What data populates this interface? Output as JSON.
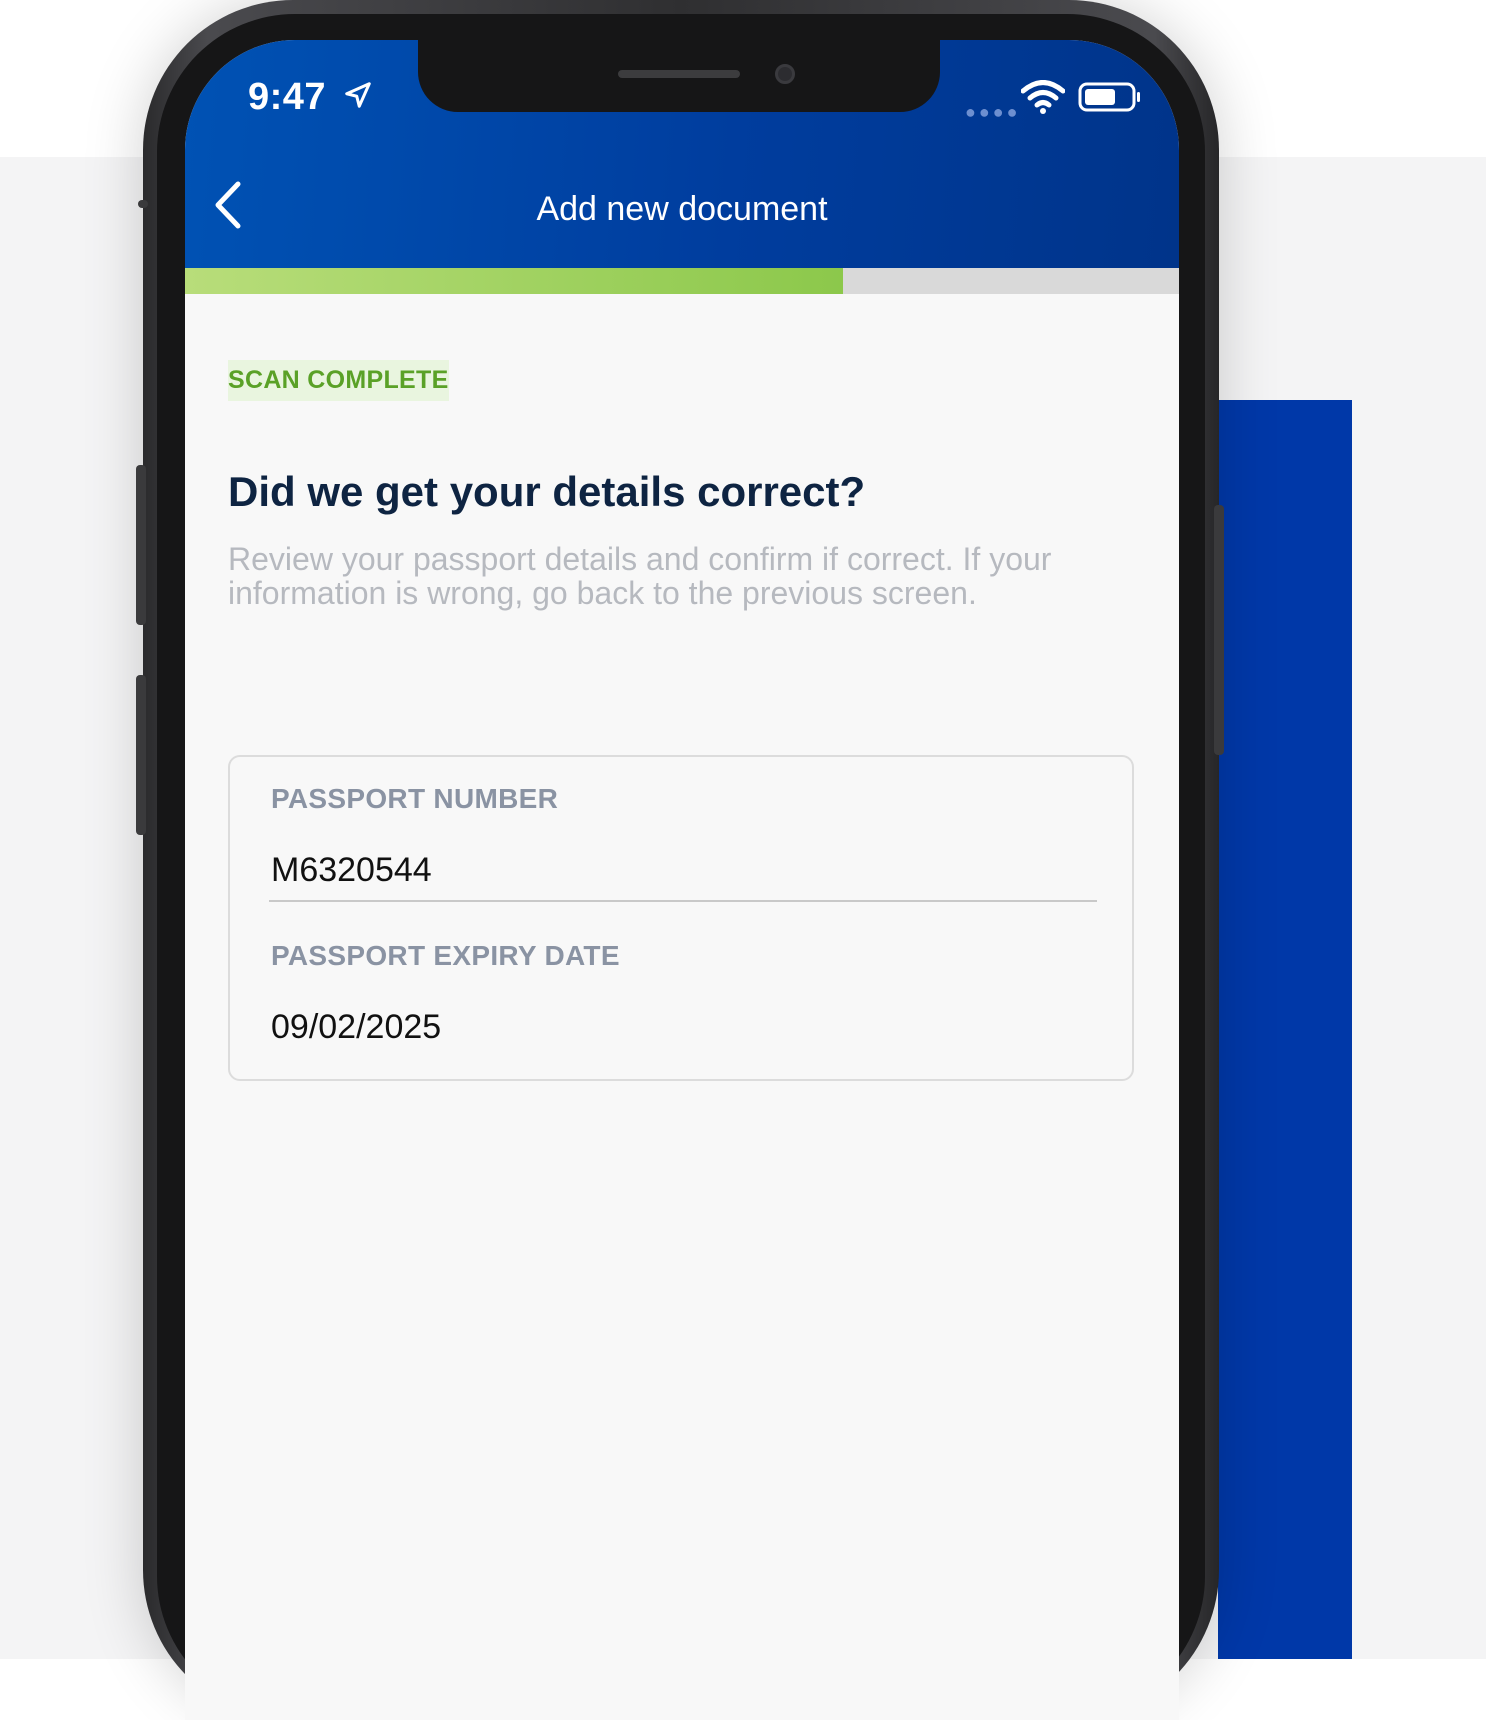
{
  "status_bar": {
    "time": "9:47"
  },
  "header": {
    "title": "Add new document"
  },
  "progress": {
    "fraction": 0.662
  },
  "content": {
    "badge": "SCAN COMPLETE",
    "heading": "Did we get your details correct?",
    "subtitle": "Review your passport details and confirm if correct. If your information is wrong, go back to the previous screen."
  },
  "fields": [
    {
      "label": "PASSPORT NUMBER",
      "value": "M6320544"
    },
    {
      "label": "PASSPORT EXPIRY DATE",
      "value": "09/02/2025"
    }
  ],
  "colors": {
    "header_blue": "#0047ab",
    "progress_green": "#8cc84b",
    "badge_green": "#5aa127",
    "heading_navy": "#0e2442"
  },
  "icons": [
    "location-arrow-icon",
    "wifi-icon",
    "battery-icon",
    "back-chevron-icon"
  ]
}
